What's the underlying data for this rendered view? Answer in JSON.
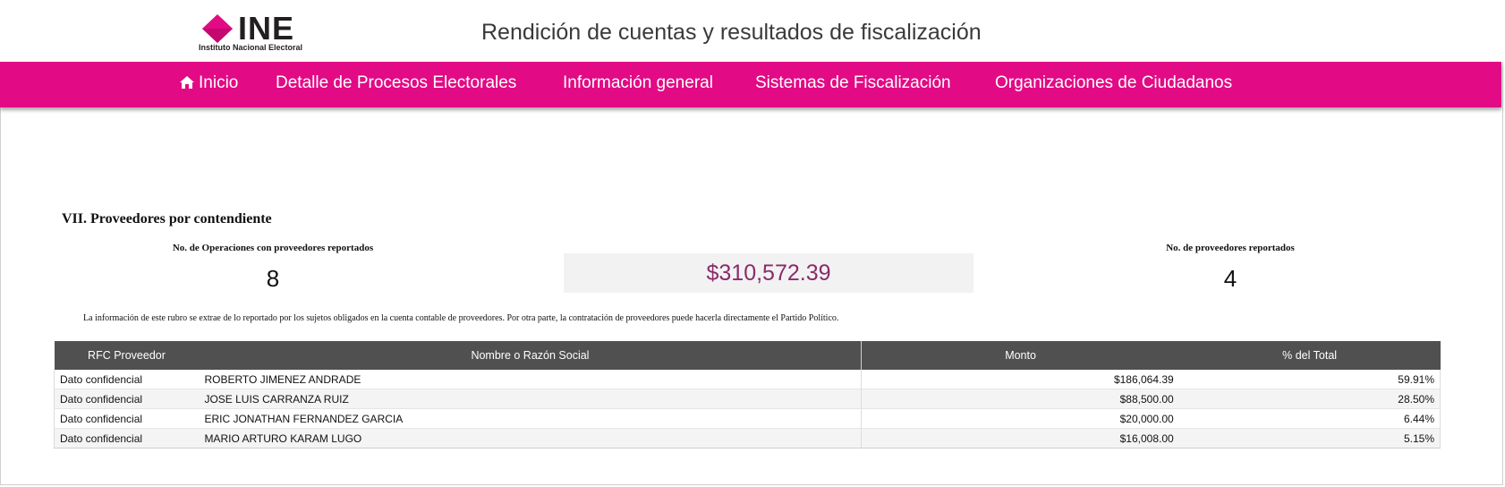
{
  "header": {
    "logo_word": "INE",
    "logo_subtitle": "Instituto Nacional Electoral",
    "site_title": "Rendición de cuentas y resultados de fiscalización"
  },
  "nav": {
    "items": [
      {
        "label": "Inicio",
        "icon": "home-icon"
      },
      {
        "label": "Detalle de Procesos Electorales"
      },
      {
        "label": "Información general"
      },
      {
        "label": "Sistemas de Fiscalización"
      },
      {
        "label": "Organizaciones de Ciudadanos"
      }
    ]
  },
  "section": {
    "title": "VII. Proveedores por contendiente",
    "operations_label": "No. de Operaciones con proveedores reportados",
    "operations_value": "8",
    "total_amount": "$310,572.39",
    "providers_label": "No. de proveedores reportados",
    "providers_value": "4",
    "note": "La información de este rubro se extrae de lo reportado por los sujetos obligados en la cuenta contable de proveedores. Por otra parte, la contratación de proveedores puede hacerla directamente el Partido Político."
  },
  "table": {
    "headers": [
      "RFC Proveedor",
      "Nombre o Razón Social",
      "Monto",
      "% del Total"
    ],
    "rows": [
      {
        "rfc": "Dato confidencial",
        "name": "ROBERTO JIMENEZ ANDRADE",
        "amount": "$186,064.39",
        "pct": "59.91%"
      },
      {
        "rfc": "Dato confidencial",
        "name": "JOSE LUIS CARRANZA RUIZ",
        "amount": "$88,500.00",
        "pct": "28.50%"
      },
      {
        "rfc": "Dato confidencial",
        "name": "ERIC JONATHAN FERNANDEZ GARCIA",
        "amount": "$20,000.00",
        "pct": "6.44%"
      },
      {
        "rfc": "Dato confidencial",
        "name": "MARIO ARTURO KARAM LUGO",
        "amount": "$16,008.00",
        "pct": "5.15%"
      }
    ]
  },
  "colors": {
    "brand_pink": "#e20a85",
    "amount_purple": "#8b2a6c",
    "table_header": "#505050"
  }
}
